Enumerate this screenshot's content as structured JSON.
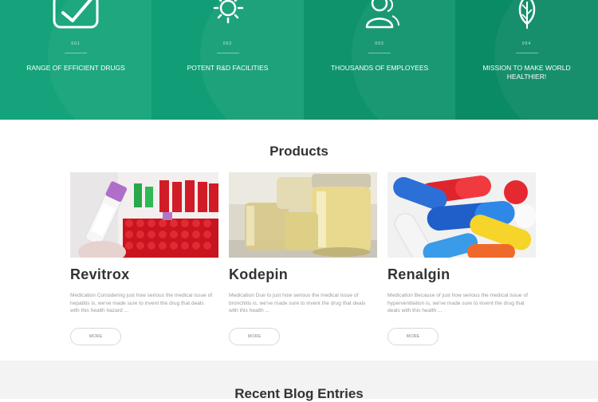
{
  "features": [
    {
      "number": "001",
      "title": "RANGE OF EFFICIENT DRUGS",
      "icon": "checkmark-icon"
    },
    {
      "number": "002",
      "title": "POTENT R&D FACILITIES",
      "icon": "sun-icon"
    },
    {
      "number": "003",
      "title": "THOUSANDS OF EMPLOYEES",
      "icon": "users-icon"
    },
    {
      "number": "004",
      "title": "MISSION TO MAKE WORLD HEALTHIER!",
      "icon": "leaf-icon"
    }
  ],
  "products": {
    "heading": "Products",
    "items": [
      {
        "name": "Revitrox",
        "description": "Medication Considering just how serious the medical issue of hepatitis is, we've made sure to invent the drug that deals with this health hazard ...",
        "more_label": "MORE"
      },
      {
        "name": "Kodepin",
        "description": "Medication Due to just how serious the medical issue of bronchitis is, we've made sure to invent the drug that deals with this health ...",
        "more_label": "MORE"
      },
      {
        "name": "Renalgin",
        "description": "Medication Because of just how serious the medical issue of hyperventilation is, we've made sure to invent the drug that deals with this health ...",
        "more_label": "MORE"
      }
    ]
  },
  "blog": {
    "heading": "Recent Blog Entries"
  },
  "colors": {
    "accent": "#14a37a",
    "heading": "#333333",
    "muted": "#9a9a9a"
  }
}
